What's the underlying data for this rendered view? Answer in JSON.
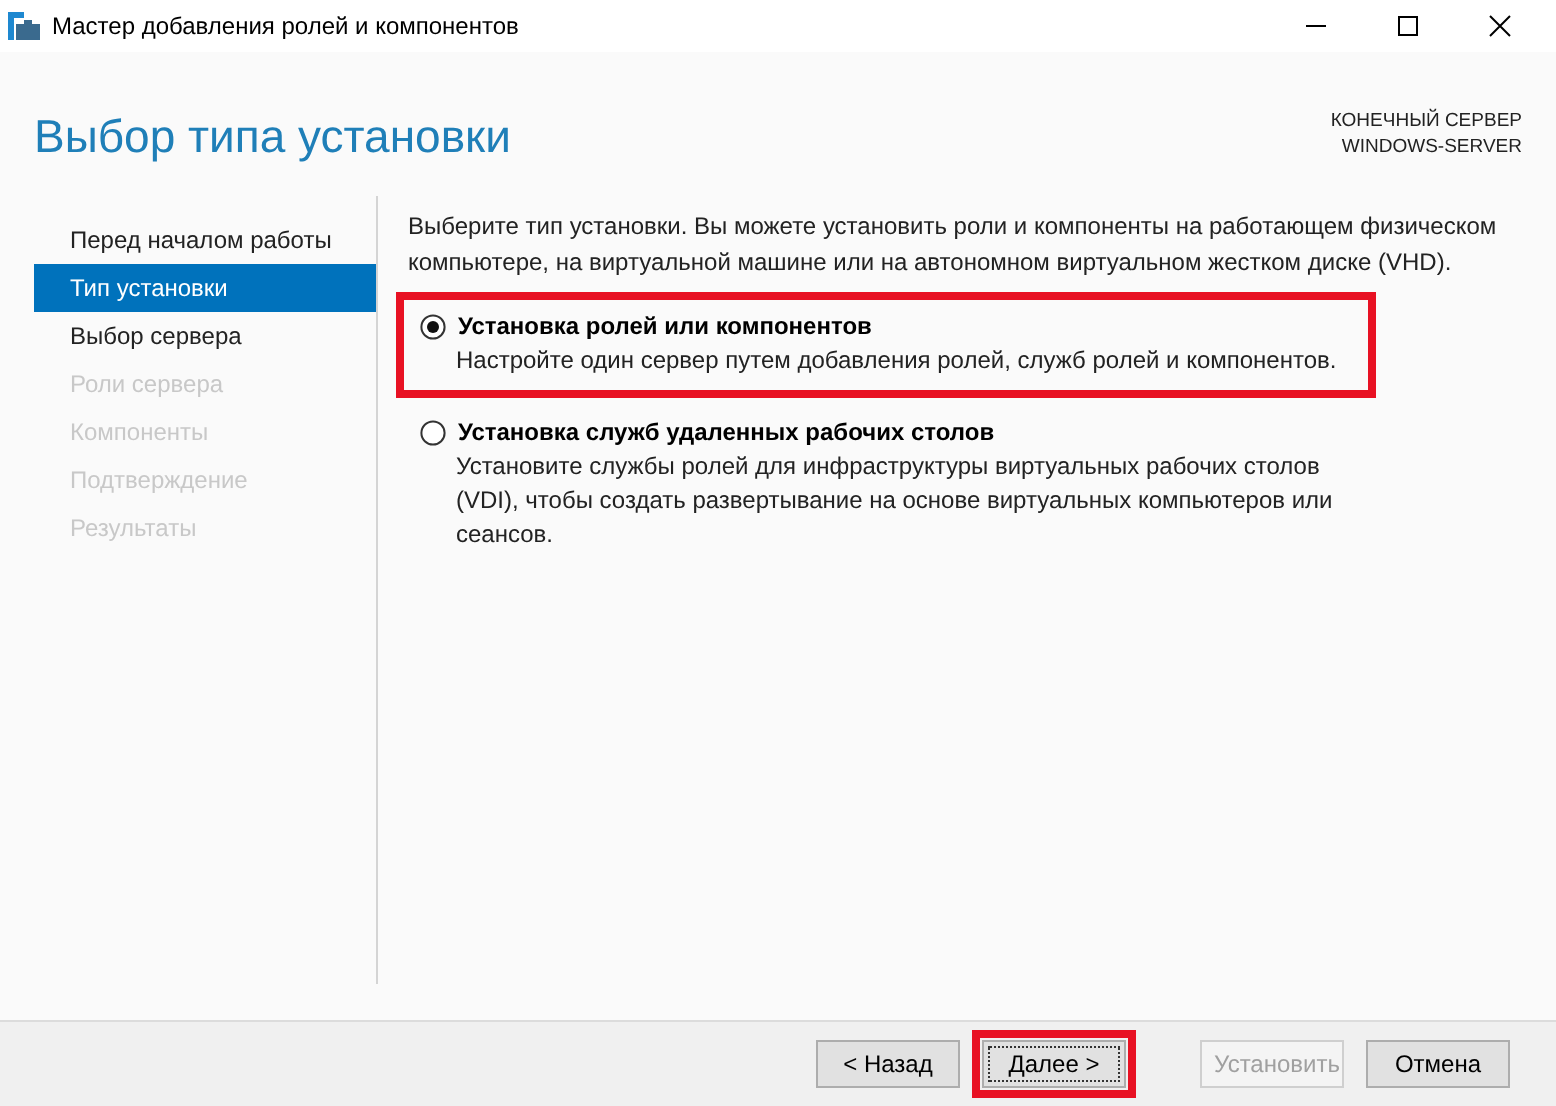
{
  "window": {
    "title": "Мастер добавления ролей и компонентов"
  },
  "header": {
    "title": "Выбор типа установки",
    "server_label": "КОНЕЧНЫЙ СЕРВЕР",
    "server_name": "WINDOWS-SERVER"
  },
  "sidebar": {
    "items": [
      {
        "label": "Перед началом работы",
        "selected": false,
        "disabled": false
      },
      {
        "label": "Тип установки",
        "selected": true,
        "disabled": false
      },
      {
        "label": "Выбор сервера",
        "selected": false,
        "disabled": false
      },
      {
        "label": "Роли сервера",
        "selected": false,
        "disabled": true
      },
      {
        "label": "Компоненты",
        "selected": false,
        "disabled": true
      },
      {
        "label": "Подтверждение",
        "selected": false,
        "disabled": true
      },
      {
        "label": "Результаты",
        "selected": false,
        "disabled": true
      }
    ]
  },
  "intro": "Выберите тип установки. Вы можете установить роли и компоненты на работающем физическом компьютере, на виртуальной машине или на автономном виртуальном жестком диске (VHD).",
  "options": [
    {
      "label": "Установка ролей или компонентов",
      "description": "Настройте один сервер путем добавления ролей, служб ролей и компонентов.",
      "selected": true,
      "highlighted": true
    },
    {
      "label": "Установка служб удаленных рабочих столов",
      "description": "Установите службы ролей для инфраструктуры виртуальных рабочих столов (VDI), чтобы создать развертывание на основе виртуальных компьютеров или сеансов.",
      "selected": false,
      "highlighted": false
    }
  ],
  "buttons": [
    {
      "label": "< Назад",
      "disabled": false,
      "focused": false,
      "highlighted": false
    },
    {
      "label": "Далее >",
      "disabled": false,
      "focused": true,
      "highlighted": true
    },
    {
      "label": "Установить",
      "disabled": true,
      "focused": false,
      "highlighted": false
    },
    {
      "label": "Отмена",
      "disabled": false,
      "focused": false,
      "highlighted": false
    }
  ]
}
